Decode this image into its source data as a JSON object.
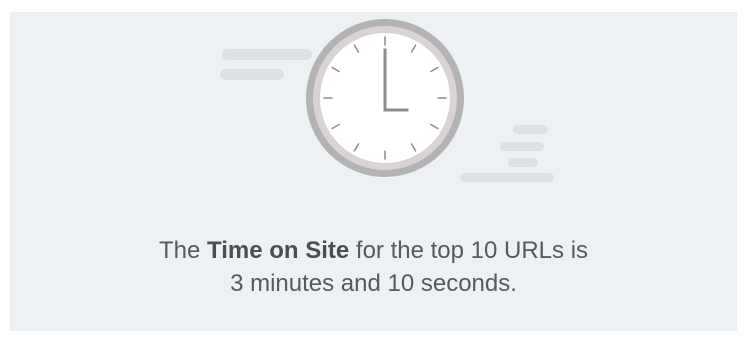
{
  "illustration": {
    "icon": "clock-icon",
    "decoration": "speed-lines-icon",
    "colors": {
      "clock_face": "#ffffff",
      "clock_ring": "#b3b3b3",
      "clock_inner_ring": "#d9d3d8",
      "clock_hands": "#8c8c8c",
      "speed_lines": "#dde0e4"
    }
  },
  "message": {
    "prefix": "The ",
    "highlight": "Time on Site",
    "suffix": " for the top 10 URLs is",
    "line2": "3 minutes and 10 seconds."
  },
  "colors": {
    "background": "#eef1f4",
    "text": "#555a60"
  }
}
